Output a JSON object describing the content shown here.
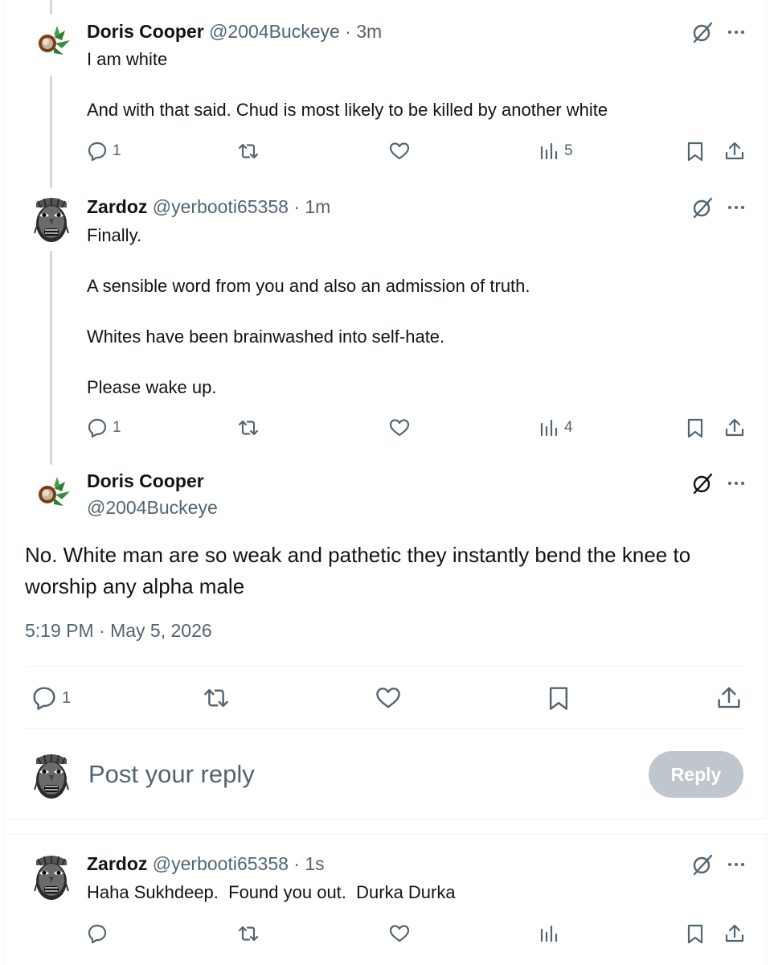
{
  "posts": [
    {
      "name": "Doris Cooper",
      "handle": "@2004Buckeye",
      "time_sep": " · ",
      "time": "3m",
      "paragraphs": [
        "I am white",
        "And with that said. Chud is most likely to be killed by another white"
      ],
      "replies": "1",
      "views": "5"
    },
    {
      "name": "Zardoz",
      "handle": "@yerbooti65358",
      "time_sep": " · ",
      "time": "1m",
      "paragraphs": [
        "Finally.",
        "A sensible word from you and also an admission of truth.",
        "Whites have been brainwashed into self-hate.",
        "Please wake up."
      ],
      "replies": "1",
      "views": "4"
    }
  ],
  "main_post": {
    "name": "Doris Cooper",
    "handle": "@2004Buckeye",
    "text": "No. White man are so weak and pathetic they instantly bend the knee to worship any alpha male",
    "timestamp": "5:19 PM · May 5, 2026",
    "replies": "1"
  },
  "reply_composer": {
    "placeholder": "Post your reply",
    "button_label": "Reply"
  },
  "last_reply": {
    "name": "Zardoz",
    "handle": "@yerbooti65358",
    "time_sep": " · ",
    "time": "1s",
    "text": "Haha Sukhdeep.  Found you out.  Durka Durka"
  },
  "colors": {
    "text_primary": "#0f1419",
    "text_secondary": "#536471",
    "thread_line": "#cfd9de",
    "divider": "#eff3f4"
  },
  "icons": {
    "actions": [
      "reply-icon",
      "repost-icon",
      "like-icon",
      "views-icon",
      "bookmark-icon",
      "share-icon"
    ],
    "top": [
      "grok-icon",
      "more-icon"
    ]
  }
}
